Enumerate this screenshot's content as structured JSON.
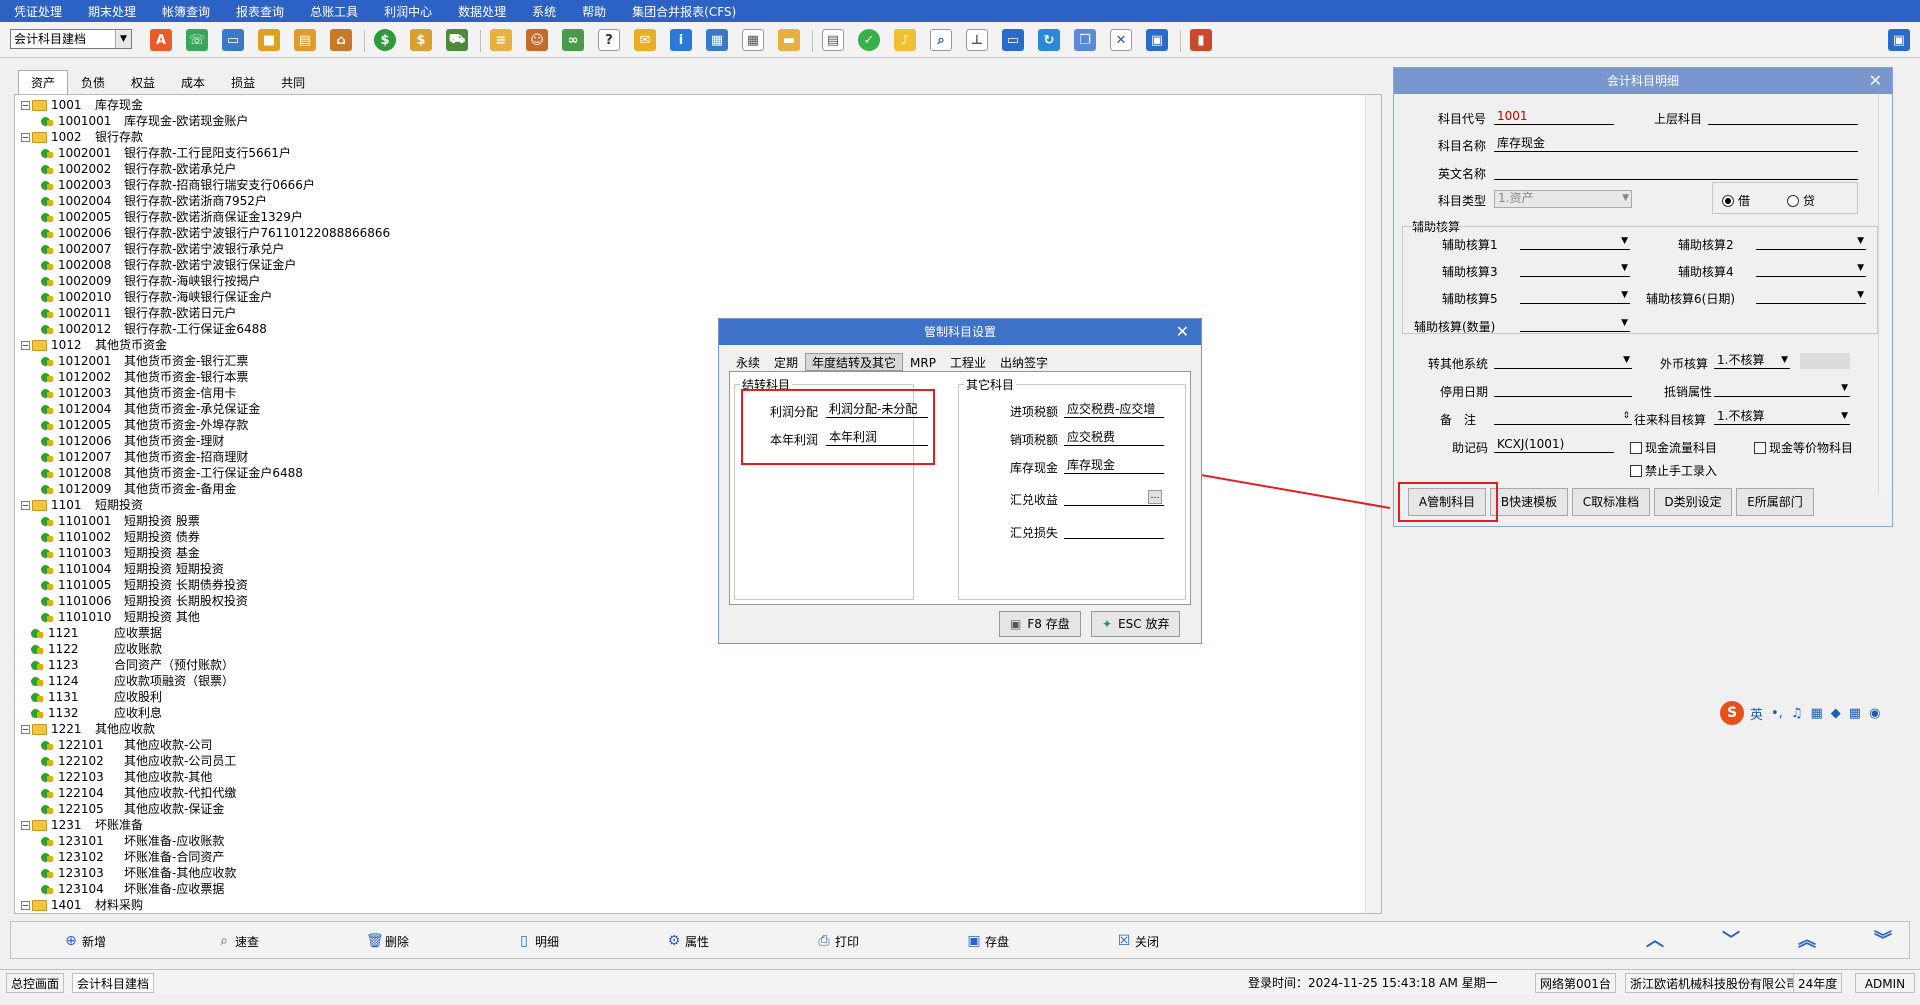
{
  "menu": [
    "凭证处理",
    "期末处理",
    "帐簿查询",
    "报表查询",
    "总账工具",
    "利润中心",
    "数据处理",
    "系统",
    "帮助",
    "集团合并报表(CFS)"
  ],
  "toolbar": {
    "module_select": "会计科目建档"
  },
  "tabs": [
    "资产",
    "负债",
    "权益",
    "成本",
    "损益",
    "共同"
  ],
  "tree": [
    {
      "level": 1,
      "code": "1001",
      "name": "库存现金"
    },
    {
      "level": 2,
      "code": "1001001",
      "name": "库存现金-欧诺现金账户"
    },
    {
      "level": 1,
      "code": "1002",
      "name": "银行存款"
    },
    {
      "level": 2,
      "code": "1002001",
      "name": "银行存款-工行昆阳支行5661户"
    },
    {
      "level": 2,
      "code": "1002002",
      "name": "银行存款-欧诺承兑户"
    },
    {
      "level": 2,
      "code": "1002003",
      "name": "银行存款-招商银行瑞安支行0666户"
    },
    {
      "level": 2,
      "code": "1002004",
      "name": "银行存款-欧诺浙商7952户"
    },
    {
      "level": 2,
      "code": "1002005",
      "name": "银行存款-欧诺浙商保证金1329户"
    },
    {
      "level": 2,
      "code": "1002006",
      "name": "银行存款-欧诺宁波银行户76110122088866866"
    },
    {
      "level": 2,
      "code": "1002007",
      "name": "银行存款-欧诺宁波银行承兑户"
    },
    {
      "level": 2,
      "code": "1002008",
      "name": "银行存款-欧诺宁波银行保证金户"
    },
    {
      "level": 2,
      "code": "1002009",
      "name": "银行存款-海峡银行按揭户"
    },
    {
      "level": 2,
      "code": "1002010",
      "name": "银行存款-海峡银行保证金户"
    },
    {
      "level": 2,
      "code": "1002011",
      "name": "银行存款-欧诺日元户"
    },
    {
      "level": 2,
      "code": "1002012",
      "name": "银行存款-工行保证金6488"
    },
    {
      "level": 1,
      "code": "1012",
      "name": "其他货币资金"
    },
    {
      "level": 2,
      "code": "1012001",
      "name": "其他货币资金-银行汇票"
    },
    {
      "level": 2,
      "code": "1012002",
      "name": "其他货币资金-银行本票"
    },
    {
      "level": 2,
      "code": "1012003",
      "name": "其他货币资金-信用卡"
    },
    {
      "level": 2,
      "code": "1012004",
      "name": "其他货币资金-承兑保证金"
    },
    {
      "level": 2,
      "code": "1012005",
      "name": "其他货币资金-外埠存款"
    },
    {
      "level": 2,
      "code": "1012006",
      "name": "其他货币资金-理财"
    },
    {
      "level": 2,
      "code": "1012007",
      "name": "其他货币资金-招商理财"
    },
    {
      "level": 2,
      "code": "1012008",
      "name": "其他货币资金-工行保证金户6488"
    },
    {
      "level": 2,
      "code": "1012009",
      "name": "其他货币资金-备用金"
    },
    {
      "level": 1,
      "code": "1101",
      "name": "短期投资"
    },
    {
      "level": 2,
      "code": "1101001",
      "name": "短期投资 股票"
    },
    {
      "level": 2,
      "code": "1101002",
      "name": "短期投资 债券"
    },
    {
      "level": 2,
      "code": "1101003",
      "name": "短期投资 基金"
    },
    {
      "level": 2,
      "code": "1101004",
      "name": "短期投资 短期投资"
    },
    {
      "level": 2,
      "code": "1101005",
      "name": "短期投资 长期债券投资"
    },
    {
      "level": 2,
      "code": "1101006",
      "name": "短期投资 长期股权投资"
    },
    {
      "level": 2,
      "code": "1101010",
      "name": "短期投资 其他"
    },
    {
      "level": 0,
      "code": "1121",
      "name": "应收票据"
    },
    {
      "level": 0,
      "code": "1122",
      "name": "应收账款"
    },
    {
      "level": 0,
      "code": "1123",
      "name": "合同资产（预付账款）"
    },
    {
      "level": 0,
      "code": "1124",
      "name": "应收款项融资（银票）"
    },
    {
      "level": 0,
      "code": "1131",
      "name": "应收股利"
    },
    {
      "level": 0,
      "code": "1132",
      "name": "应收利息"
    },
    {
      "level": 1,
      "code": "1221",
      "name": "其他应收款"
    },
    {
      "level": 2,
      "code": "122101",
      "name": "其他应收款-公司"
    },
    {
      "level": 2,
      "code": "122102",
      "name": "其他应收款-公司员工"
    },
    {
      "level": 2,
      "code": "122103",
      "name": "其他应收款-其他"
    },
    {
      "level": 2,
      "code": "122104",
      "name": "其他应收款-代扣代缴"
    },
    {
      "level": 2,
      "code": "122105",
      "name": "其他应收款-保证金"
    },
    {
      "level": 1,
      "code": "1231",
      "name": "坏账准备"
    },
    {
      "level": 2,
      "code": "123101",
      "name": "坏账准备-应收账款"
    },
    {
      "level": 2,
      "code": "123102",
      "name": "坏账准备-合同资产"
    },
    {
      "level": 2,
      "code": "123103",
      "name": "坏账准备-其他应收款"
    },
    {
      "level": 2,
      "code": "123104",
      "name": "坏账准备-应收票据"
    },
    {
      "level": 1,
      "code": "1401",
      "name": "材料采购"
    }
  ],
  "bottom_buttons": [
    "新增",
    "速查",
    "删除",
    "明细",
    "属性",
    "打印",
    "存盘",
    "关闭"
  ],
  "status": {
    "tab_home": "总控画面",
    "tab_current": "会计科目建档",
    "login_label": "登录时间：",
    "login_time": "2024-11-25 15:43:18 AM",
    "weekday": "星期一",
    "station": "网络第001台",
    "company": "浙江欧诺机械科技股份有限公司",
    "year": "24年度",
    "user": "ADMIN"
  },
  "panel": {
    "title": "会计科目明细",
    "code_label": "科目代号",
    "code_value": "1001",
    "parent_label": "上层科目",
    "parent_value": "",
    "name_label": "科目名称",
    "name_value": "库存现金",
    "en_label": "英文名称",
    "en_value": "",
    "type_label": "科目类型",
    "type_value": "1.资产",
    "debit": "借",
    "credit": "贷",
    "aux_group": "辅助核算",
    "aux1": "辅助核算1",
    "aux2": "辅助核算2",
    "aux3": "辅助核算3",
    "aux4": "辅助核算4",
    "aux5": "辅助核算5",
    "aux6": "辅助核算6(日期)",
    "aux_qty": "辅助核算(数量)",
    "transfer_label": "转其他系统",
    "fx_label": "外币核算",
    "fx_value": "1.不核算",
    "stop_label": "停用日期",
    "offset_label": "抵销属性",
    "note_label": "备　注",
    "ar_label": "往来科目核算",
    "ar_value": "1.不核算",
    "memo_label": "助记码",
    "memo_value": "KCXJ(1001)",
    "chk_cashflow": "现金流量科目",
    "chk_cashequiv": "现金等价物科目",
    "chk_manual": "禁止手工录入",
    "btn_a": "A管制科目",
    "btn_b": "B快速模板",
    "btn_c": "C取标准档",
    "btn_d": "D类别设定",
    "btn_e": "E所属部门"
  },
  "dialog": {
    "title": "管制科目设置",
    "tabs": [
      "永续",
      "定期",
      "年度结转及其它",
      "MRP",
      "工程业",
      "出纳签字"
    ],
    "group_left": "结转科目",
    "group_right": "其它科目",
    "profit_dist_label": "利润分配",
    "profit_dist_value": "利润分配-未分配",
    "cur_profit_label": "本年利润",
    "cur_profit_value": "本年利润",
    "input_tax_label": "进项税额",
    "input_tax_value": "应交税费-应交增",
    "output_tax_label": "销项税额",
    "output_tax_value": "应交税费",
    "cash_label": "库存现金",
    "cash_value": "库存现金",
    "fx_gain_label": "汇兑收益",
    "fx_loss_label": "汇兑损失",
    "save_btn": "F8 存盘",
    "cancel_btn": "ESC 放弃"
  },
  "ime": {
    "lang": "英"
  }
}
